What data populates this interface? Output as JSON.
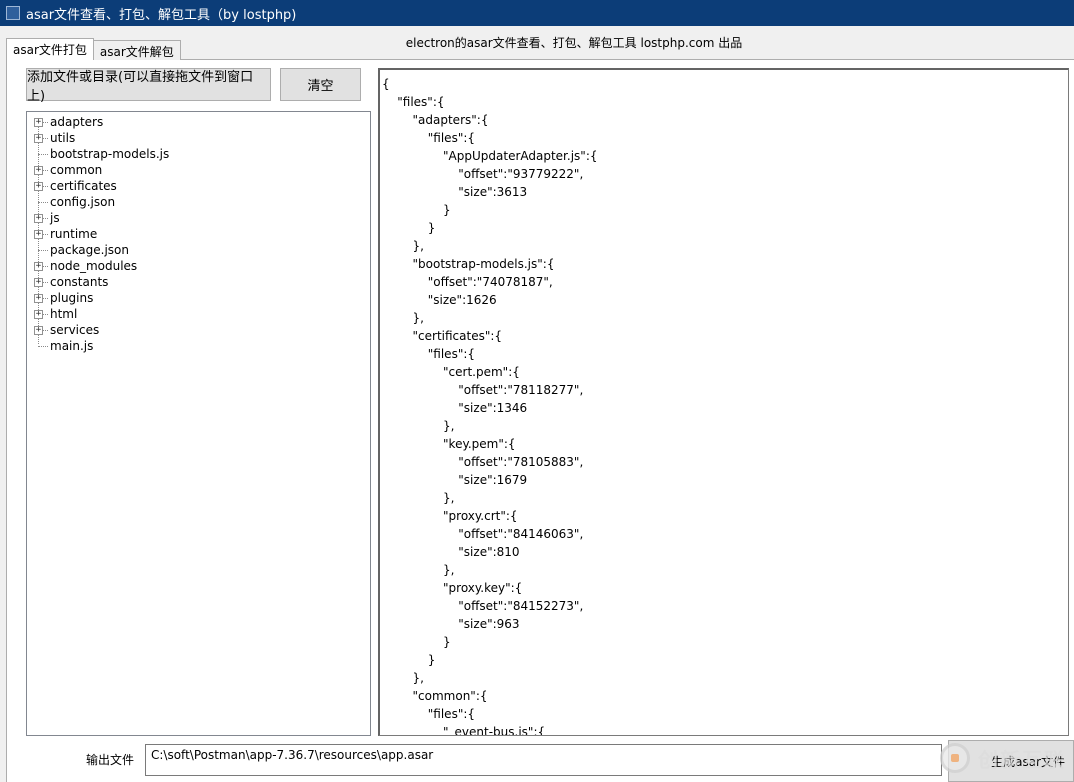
{
  "window": {
    "title": "asar文件查看、打包、解包工具（by lostphp)"
  },
  "tabs": [
    {
      "label": "asar文件打包",
      "active": true
    },
    {
      "label": "asar文件解包",
      "active": false
    }
  ],
  "header": {
    "text": "electron的asar文件查看、打包、解包工具 lostphp.com 出品"
  },
  "buttons": {
    "add_label": "添加文件或目录(可以直接拖文件到窗口上)",
    "clear_label": "清空",
    "generate_label": "生成asar文件"
  },
  "tree": {
    "items": [
      {
        "label": "adapters",
        "expandable": true
      },
      {
        "label": "utils",
        "expandable": true
      },
      {
        "label": "bootstrap-models.js",
        "expandable": false
      },
      {
        "label": "common",
        "expandable": true
      },
      {
        "label": "certificates",
        "expandable": true
      },
      {
        "label": "config.json",
        "expandable": false
      },
      {
        "label": "js",
        "expandable": true
      },
      {
        "label": "runtime",
        "expandable": true
      },
      {
        "label": "package.json",
        "expandable": false
      },
      {
        "label": "node_modules",
        "expandable": true
      },
      {
        "label": "constants",
        "expandable": true
      },
      {
        "label": "plugins",
        "expandable": true
      },
      {
        "label": "html",
        "expandable": true
      },
      {
        "label": "services",
        "expandable": true
      },
      {
        "label": "main.js",
        "expandable": false
      }
    ]
  },
  "json_view": {
    "lines": [
      "{",
      "    \"files\":{",
      "        \"adapters\":{",
      "            \"files\":{",
      "                \"AppUpdaterAdapter.js\":{",
      "                    \"offset\":\"93779222\",",
      "                    \"size\":3613",
      "                }",
      "            }",
      "        },",
      "        \"bootstrap-models.js\":{",
      "            \"offset\":\"74078187\",",
      "            \"size\":1626",
      "        },",
      "        \"certificates\":{",
      "            \"files\":{",
      "                \"cert.pem\":{",
      "                    \"offset\":\"78118277\",",
      "                    \"size\":1346",
      "                },",
      "                \"key.pem\":{",
      "                    \"offset\":\"78105883\",",
      "                    \"size\":1679",
      "                },",
      "                \"proxy.crt\":{",
      "                    \"offset\":\"84146063\",",
      "                    \"size\":810",
      "                },",
      "                \"proxy.key\":{",
      "                    \"offset\":\"84152273\",",
      "                    \"size\":963",
      "                }",
      "            }",
      "        },",
      "        \"common\":{",
      "            \"files\":{",
      "                \"_event-bus.js\":{"
    ]
  },
  "output": {
    "label": "输出文件",
    "value": "C:\\soft\\Postman\\app-7.36.7\\resources\\app.asar"
  },
  "watermark": {
    "text": "创新互联"
  }
}
